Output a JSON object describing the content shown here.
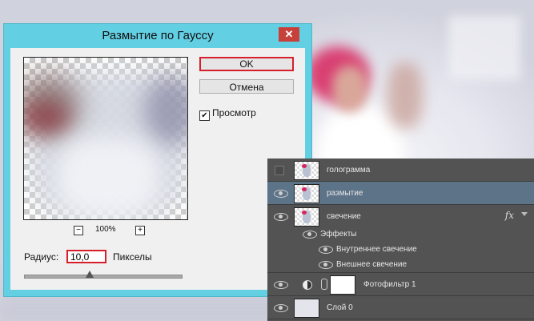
{
  "dialog": {
    "title": "Размытие по Гауссу",
    "close_symbol": "✕",
    "ok_label": "OK",
    "cancel_label": "Отмена",
    "preview_label": "Просмотр",
    "preview_checked": true,
    "preview_check_symbol": "✔",
    "zoom_minus": "−",
    "zoom_plus": "+",
    "zoom_value": "100%",
    "radius_label": "Радиус:",
    "radius_value": "10,0",
    "radius_unit": "Пикселы",
    "slider_fraction": 0.42,
    "highlight_color": "#d61f2b",
    "titlebar_color": "#63cfe3"
  },
  "layers_panel": {
    "layers": [
      {
        "name": "голограмма",
        "visible": false,
        "selected": false
      },
      {
        "name": "размытие",
        "visible": true,
        "selected": true
      },
      {
        "name": "свечение",
        "visible": true,
        "selected": false,
        "fx_label": "fx"
      },
      {
        "name": "Фотофильтр 1",
        "visible": true,
        "selected": false
      },
      {
        "name": "Слой 0",
        "visible": true,
        "selected": false
      }
    ],
    "effects": {
      "label": "Эффекты",
      "items": [
        "Внутреннее свечение",
        "Внешнее свечение"
      ]
    },
    "selected_color": "#5d7388",
    "panel_color": "#535353"
  }
}
